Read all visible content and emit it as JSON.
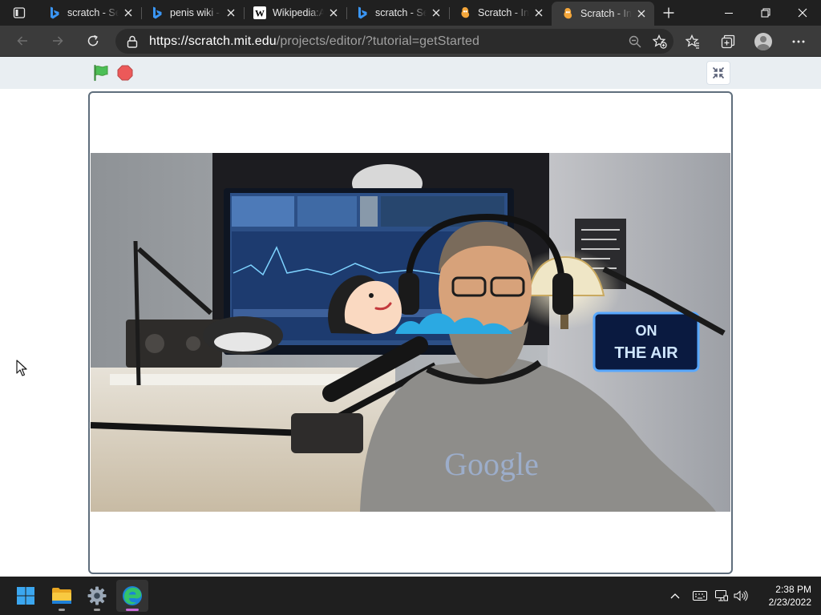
{
  "browser": {
    "tabs": [
      {
        "title": "scratch - Se",
        "favicon": "bing-icon",
        "active": false
      },
      {
        "title": "penis wiki -",
        "favicon": "bing-icon",
        "active": false
      },
      {
        "title": "Wikipedia:A",
        "favicon": "wikipedia-icon",
        "active": false
      },
      {
        "title": "scratch - Se",
        "favicon": "bing-icon",
        "active": false
      },
      {
        "title": "Scratch - In",
        "favicon": "scratch-icon",
        "active": false
      },
      {
        "title": "Scratch - In",
        "favicon": "scratch-icon",
        "active": true
      }
    ],
    "url_host": "https://scratch.mit.edu",
    "url_path": "/projects/editor/?tutorial=getStarted",
    "colors": {
      "tabstrip": "#202020",
      "toolbar": "#3b3b3b",
      "omnibox": "#2b2b2b"
    }
  },
  "scratch": {
    "green_flag": "green-flag-icon",
    "stop": "stop-icon",
    "exit_fullscreen": "unfullscreen-icon",
    "colors": {
      "header": "#e9eef2",
      "frame_border": "#5f6e7c",
      "flag": "#4cbf56",
      "stop": "#ec5959"
    }
  },
  "stage_video": {
    "screen_sign": "ON THE AIR",
    "shirt_text": "Google",
    "sprite": "sleeping-character-sprite"
  },
  "taskbar": {
    "apps": [
      "windows-start-icon",
      "file-explorer-icon",
      "settings-icon",
      "edge-icon"
    ],
    "time": "2:38 PM",
    "date": "2/23/2022"
  }
}
